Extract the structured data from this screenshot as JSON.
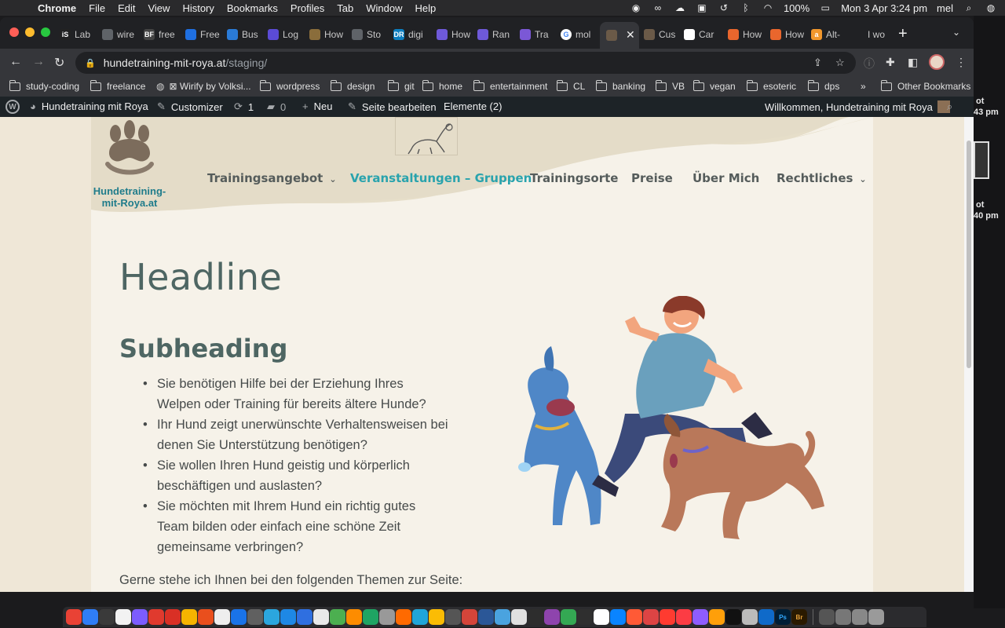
{
  "menubar": {
    "app": "Chrome",
    "items": [
      "File",
      "Edit",
      "View",
      "History",
      "Bookmarks",
      "Profiles",
      "Tab",
      "Window",
      "Help"
    ],
    "battery": "100%",
    "datetime": "Mon 3 Apr  3:24 pm",
    "user": "mel"
  },
  "desktop": {
    "label1_line1": "ot",
    "label1_line2": "43 pm",
    "label2_line1": "ot",
    "label2_line2": "40 pm"
  },
  "tabs": [
    {
      "label": "Lab",
      "icon": "iS",
      "color": "#222222"
    },
    {
      "label": "wire",
      "icon": "globe",
      "color": "#5f6368"
    },
    {
      "label": "free",
      "icon": "BF",
      "color": "#444444"
    },
    {
      "label": "Free",
      "icon": "dropbox",
      "color": "#1f6fe0"
    },
    {
      "label": "Bus",
      "icon": "doc",
      "color": "#2a7bd8"
    },
    {
      "label": "Log",
      "icon": "grid",
      "color": "#5b4bd6"
    },
    {
      "label": "How",
      "icon": "circle",
      "color": "#8a6d3b"
    },
    {
      "label": "Sto",
      "icon": "globe",
      "color": "#5f6368"
    },
    {
      "label": "digi",
      "icon": "DR",
      "color": "#0c7ec0"
    },
    {
      "label": "How",
      "icon": "chart",
      "color": "#6e59d9"
    },
    {
      "label": "Ran",
      "icon": "chart",
      "color": "#6e59d9"
    },
    {
      "label": "Tra",
      "icon": "script",
      "color": "#7b58d6"
    },
    {
      "label": "mol",
      "icon": "G",
      "color": "#ffffff"
    },
    {
      "label": "",
      "icon": "paw",
      "color": "#6b5a48",
      "active": true
    },
    {
      "label": "Cus",
      "icon": "paw",
      "color": "#6b5a48"
    },
    {
      "label": "Car",
      "icon": "flag",
      "color": "#ffffff"
    },
    {
      "label": "How",
      "icon": "bus",
      "color": "#e9662d"
    },
    {
      "label": "How",
      "icon": "bus",
      "color": "#e9662d"
    },
    {
      "label": "Alt-",
      "icon": "a",
      "color": "#f1972c"
    },
    {
      "label": "I wo",
      "icon": "",
      "color": "transparent"
    }
  ],
  "address": {
    "host": "hundetraining-mit-roya.at",
    "path": "/staging/"
  },
  "bookmarks": {
    "items": [
      {
        "label": "study-coding",
        "type": "folder"
      },
      {
        "label": "freelance",
        "type": "folder"
      },
      {
        "label": "⊠ Wirify by Volksi...",
        "type": "globe"
      },
      {
        "label": "wordpress",
        "type": "folder"
      },
      {
        "label": "design",
        "type": "folder"
      },
      {
        "label": "git",
        "type": "folder"
      },
      {
        "label": "home",
        "type": "folder"
      },
      {
        "label": "entertainment",
        "type": "folder"
      },
      {
        "label": "CL",
        "type": "folder"
      },
      {
        "label": "banking",
        "type": "folder"
      },
      {
        "label": "VB",
        "type": "folder"
      },
      {
        "label": "vegan",
        "type": "folder"
      },
      {
        "label": "esoteric",
        "type": "folder"
      },
      {
        "label": "dps",
        "type": "folder"
      }
    ],
    "more": "»",
    "other": "Other Bookmarks"
  },
  "wp_admin": {
    "site": "Hundetraining mit Roya",
    "customizer": "Customizer",
    "updates": "1",
    "comments": "0",
    "new": "Neu",
    "edit": "Seite bearbeiten",
    "elements": "Elemente (2)",
    "welcome": "Willkommen, Hundetraining mit Roya"
  },
  "site": {
    "logo_line1": "Hundetraining-",
    "logo_line2": "mit-Roya.at",
    "nav": [
      {
        "label": "Trainingsangebot",
        "dropdown": true
      },
      {
        "label": "Veranstaltungen – Gruppen",
        "current": true
      },
      {
        "label": "Trainingsorte"
      },
      {
        "label": "Preise"
      },
      {
        "label": "Über Mich"
      },
      {
        "label": "Rechtliches",
        "dropdown": true
      }
    ],
    "headline": "Headline",
    "subheading": "Subheading",
    "bullets": [
      "Sie benötigen Hilfe bei der Erziehung Ihres Welpen oder Training für bereits ältere Hunde?",
      "Ihr Hund zeigt unerwünschte Verhaltensweisen bei denen Sie Unterstützung benötigen?",
      "Sie wollen Ihren Hund geistig und körperlich beschäftigen und auslasten?",
      "Sie möchten mit Ihrem Hund ein richtig gutes Team bilden oder einfach eine schöne Zeit gemeinsame verbringen?"
    ],
    "intro": "Gerne stehe ich Ihnen bei den folgenden Themen zur Seite:",
    "accent_color": "#29a3ad",
    "heading_color": "#4e6663"
  },
  "dock": {
    "labels": [
      "Ps",
      "Br"
    ]
  }
}
